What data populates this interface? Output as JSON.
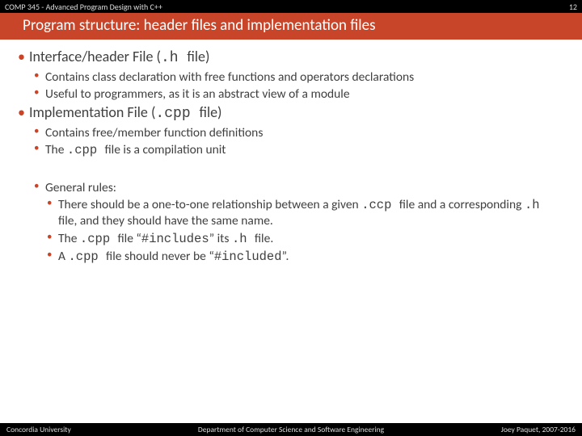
{
  "header": {
    "course": "COMP 345 - Advanced Program Design with C++",
    "page": "12"
  },
  "title": "Program structure: header files and implementation files",
  "body": {
    "s1": {
      "heading_a": "Interface/header File (",
      "heading_code": ".h ",
      "heading_b": " file)",
      "items": [
        "Contains class declaration with free functions and operators declarations",
        "Useful to programmers, as it is an abstract view of a module"
      ]
    },
    "s2": {
      "heading_a": "Implementation File (",
      "heading_code": ".cpp ",
      "heading_b": " file)",
      "items": [
        "Contains free/member function definitions"
      ],
      "item1_a": "The ",
      "item1_code": ".cpp ",
      "item1_b": " file is a compilation unit"
    },
    "s3": {
      "heading": "General rules:",
      "r0": {
        "a": "There should be a one-to-one relationship between a given ",
        "c1": ".ccp ",
        "b": " file and a corresponding ",
        "c2": ".h ",
        "d": " file, and they should have the same name."
      },
      "r1": {
        "a": "The ",
        "c1": ".cpp ",
        "b": " file “",
        "c2": "#includes",
        "d": "” its ",
        "c3": ".h ",
        "e": " file."
      },
      "r2": {
        "a": "A ",
        "c1": ".cpp ",
        "b": " file should never be “",
        "c2": "#included",
        "d": "”."
      }
    }
  },
  "footer": {
    "left": "Concordia University",
    "center": "Department of Computer Science and Software Engineering",
    "right": "Joey Paquet, 2007-2016"
  }
}
